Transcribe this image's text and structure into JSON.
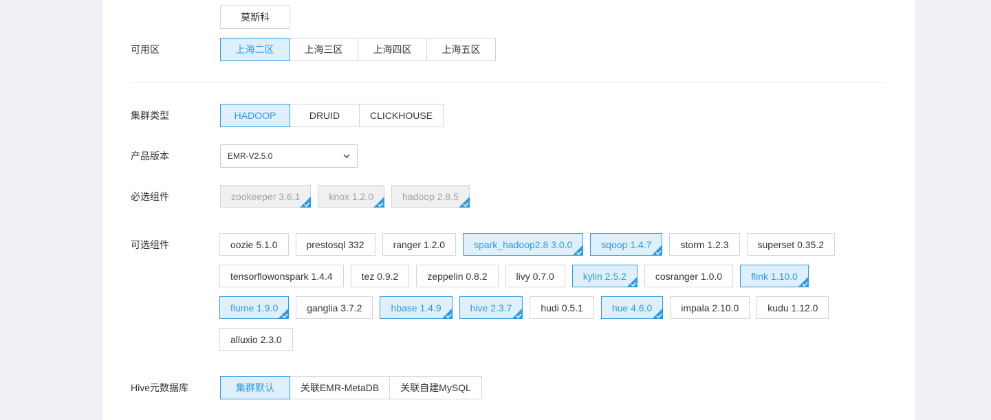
{
  "region_header": {
    "label": "",
    "selected": "莫斯科"
  },
  "zone": {
    "label": "可用区",
    "options": [
      {
        "text": "上海二区",
        "selected": true
      },
      {
        "text": "上海三区",
        "selected": false
      },
      {
        "text": "上海四区",
        "selected": false
      },
      {
        "text": "上海五区",
        "selected": false
      }
    ]
  },
  "cluster_type": {
    "label": "集群类型",
    "options": [
      {
        "text": "HADOOP",
        "selected": true
      },
      {
        "text": "DRUID",
        "selected": false
      },
      {
        "text": "CLICKHOUSE",
        "selected": false
      }
    ]
  },
  "version": {
    "label": "产品版本",
    "value": "EMR-V2.5.0"
  },
  "required": {
    "label": "必选组件",
    "items": [
      "zookeeper 3.6.1",
      "knox 1.2.0",
      "hadoop 2.8.5"
    ]
  },
  "optional": {
    "label": "可选组件",
    "rows": [
      [
        {
          "text": "oozie 5.1.0",
          "selected": false
        },
        {
          "text": "prestosql 332",
          "selected": false
        },
        {
          "text": "ranger 1.2.0",
          "selected": false
        },
        {
          "text": "spark_hadoop2.8 3.0.0",
          "selected": true
        },
        {
          "text": "sqoop 1.4.7",
          "selected": true
        },
        {
          "text": "storm 1.2.3",
          "selected": false
        },
        {
          "text": "superset 0.35.2",
          "selected": false
        }
      ],
      [
        {
          "text": "tensorflowonspark 1.4.4",
          "selected": false
        },
        {
          "text": "tez 0.9.2",
          "selected": false
        },
        {
          "text": "zeppelin 0.8.2",
          "selected": false
        },
        {
          "text": "livy 0.7.0",
          "selected": false
        },
        {
          "text": "kylin 2.5.2",
          "selected": true
        },
        {
          "text": "cosranger 1.0.0",
          "selected": false
        },
        {
          "text": "flink 1.10.0",
          "selected": true
        }
      ],
      [
        {
          "text": "flume 1.9.0",
          "selected": true
        },
        {
          "text": "ganglia 3.7.2",
          "selected": false
        },
        {
          "text": "hbase 1.4.9",
          "selected": true
        },
        {
          "text": "hive 2.3.7",
          "selected": true
        },
        {
          "text": "hudi 0.5.1",
          "selected": false
        },
        {
          "text": "hue 4.6.0",
          "selected": true
        },
        {
          "text": "impala 2.10.0",
          "selected": false
        },
        {
          "text": "kudu 1.12.0",
          "selected": false
        }
      ],
      [
        {
          "text": "alluxio 2.3.0",
          "selected": false
        }
      ]
    ]
  },
  "hive_meta": {
    "label": "Hive元数据库",
    "options": [
      {
        "text": "集群默认",
        "selected": true
      },
      {
        "text": "关联EMR-MetaDB",
        "selected": false
      },
      {
        "text": "关联自建MySQL",
        "selected": false
      }
    ]
  },
  "colors": {
    "accent": "#2d9ae2",
    "selected_bg": "#def0fd",
    "disabled_bg": "#eef0f2"
  }
}
